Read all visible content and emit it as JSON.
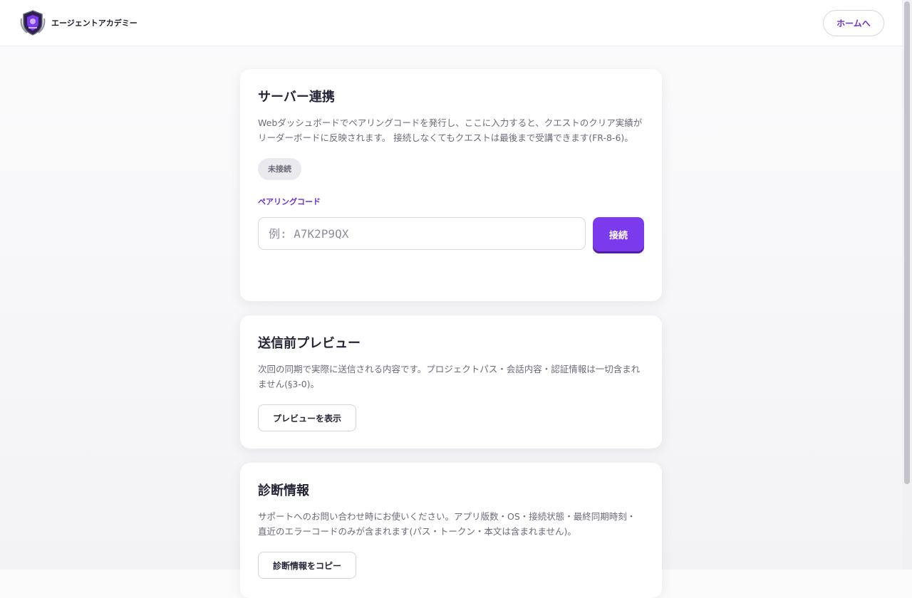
{
  "header": {
    "logo_text": "エージェントアカデミー",
    "home_button": "ホームへ"
  },
  "server_card": {
    "title": "サーバー連携",
    "description": "Webダッシュボードでペアリングコードを発行し、ここに入力すると、クエストのクリア実績がリーダーボードに反映されます。 接続しなくてもクエストは最後まで受講できます(FR-8-6)。",
    "status": "未接続",
    "field_label": "ペアリングコード",
    "input_value": "",
    "input_placeholder": "例: A7K2P9QX",
    "connect_button": "接続"
  },
  "preview_card": {
    "title": "送信前プレビュー",
    "description": "次回の同期で実際に送信される内容です。プロジェクトパス・会話内容・認証情報は一切含まれません(§3-0)。",
    "button": "プレビューを表示"
  },
  "diagnostics_card": {
    "title": "診断情報",
    "description": "サポートへのお問い合わせ時にお使いください。アプリ版数・OS・接続状態・最終同期時刻・直近のエラーコードのみが含まれます(パス・トークン・本文は含まれません)。",
    "button": "診断情報をコピー"
  },
  "colors": {
    "accent": "#7c3aed",
    "accent_text": "#6b2fd6",
    "background": "#f5f5f8"
  }
}
